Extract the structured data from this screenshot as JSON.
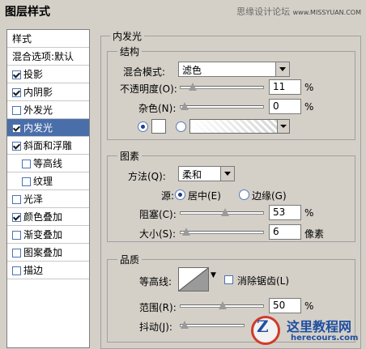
{
  "window": {
    "title": "图层样式",
    "watermark": "思缘设计论坛",
    "watermark_url": "www.MISSYUAN.COM"
  },
  "styles_list": {
    "header": "样式",
    "blend_options": "混合选项:默认",
    "items": [
      {
        "label": "投影",
        "checked": true
      },
      {
        "label": "内阴影",
        "checked": true
      },
      {
        "label": "外发光",
        "checked": false
      },
      {
        "label": "内发光",
        "checked": true,
        "selected": true
      },
      {
        "label": "斜面和浮雕",
        "checked": true
      },
      {
        "label": "等高线",
        "checked": false,
        "indent": true
      },
      {
        "label": "纹理",
        "checked": false,
        "indent": true
      },
      {
        "label": "光泽",
        "checked": false
      },
      {
        "label": "颜色叠加",
        "checked": true
      },
      {
        "label": "渐变叠加",
        "checked": false
      },
      {
        "label": "图案叠加",
        "checked": false
      },
      {
        "label": "描边",
        "checked": false
      }
    ]
  },
  "inner_glow": {
    "section_title": "内发光",
    "structure": {
      "title": "结构",
      "blend_mode_label": "混合模式:",
      "blend_mode_value": "滤色",
      "opacity_label": "不透明度(O):",
      "opacity_value": "11",
      "opacity_unit": "%",
      "noise_label": "杂色(N):",
      "noise_value": "0",
      "noise_unit": "%",
      "opacity_fraction": 0.11,
      "noise_fraction": 0.0,
      "color_radio_on": true
    },
    "elements": {
      "title": "图素",
      "technique_label": "方法(Q):",
      "technique_value": "柔和",
      "source_label": "源:",
      "source_center": "居中(E)",
      "source_edge": "边缘(G)",
      "choke_label": "阻塞(C):",
      "choke_value": "53",
      "choke_unit": "%",
      "choke_fraction": 0.53,
      "size_label": "大小(S):",
      "size_value": "6",
      "size_unit": "像素",
      "size_fraction": 0.02
    },
    "quality": {
      "title": "品质",
      "contour_label": "等高线:",
      "antialias_label": "消除锯齿(L)",
      "range_label": "范围(R):",
      "range_value": "50",
      "range_unit": "%",
      "range_fraction": 0.5,
      "jitter_label": "抖动(J):",
      "jitter_fraction": 0.0
    }
  },
  "logo": {
    "mark": "Z",
    "cn": "这里教程网",
    "en": "herecours.com"
  }
}
